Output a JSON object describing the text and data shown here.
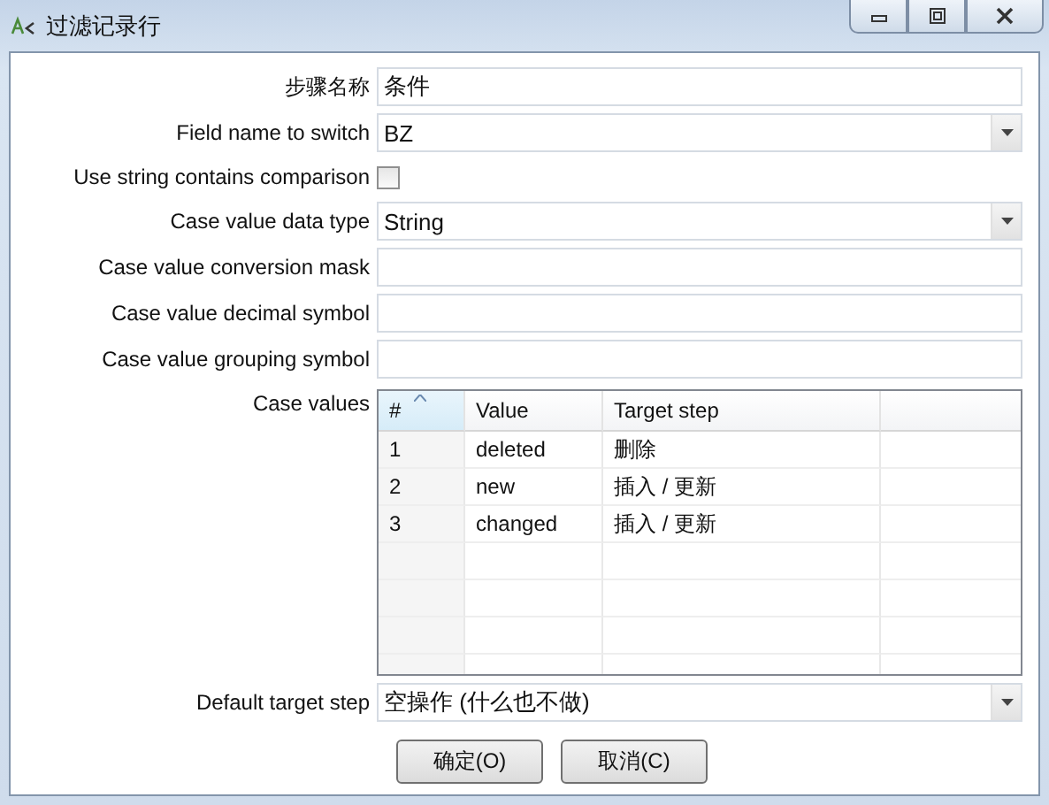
{
  "window": {
    "title": "过滤记录行"
  },
  "fields": [
    {
      "label": "步骤名称",
      "kind": "text",
      "value": "条件"
    },
    {
      "label": "Field name to switch",
      "kind": "dropdown",
      "value": "BZ"
    },
    {
      "label": "Use string contains comparison",
      "kind": "checkbox",
      "checked": false
    },
    {
      "label": "Case value data type",
      "kind": "dropdown",
      "value": "String"
    },
    {
      "label": "Case value conversion mask",
      "kind": "text"
    },
    {
      "label": "Case value decimal symbol",
      "kind": "text"
    },
    {
      "label": "Case value grouping symbol",
      "kind": "text"
    }
  ],
  "case_values": {
    "label": "Case values",
    "columns": [
      "#",
      "Value",
      "Target step"
    ],
    "rows": [
      {
        "number": "1",
        "value": "deleted",
        "target_step": "删除"
      },
      {
        "number": "2",
        "value": "new",
        "target_step": "插入 / 更新"
      },
      {
        "number": "3",
        "value": "changed",
        "target_step": "插入 / 更新"
      }
    ]
  },
  "default_target": {
    "label": "Default target step",
    "value": "空操作 (什么也不做)"
  },
  "buttons": [
    "确定(O)",
    "取消(C)"
  ]
}
